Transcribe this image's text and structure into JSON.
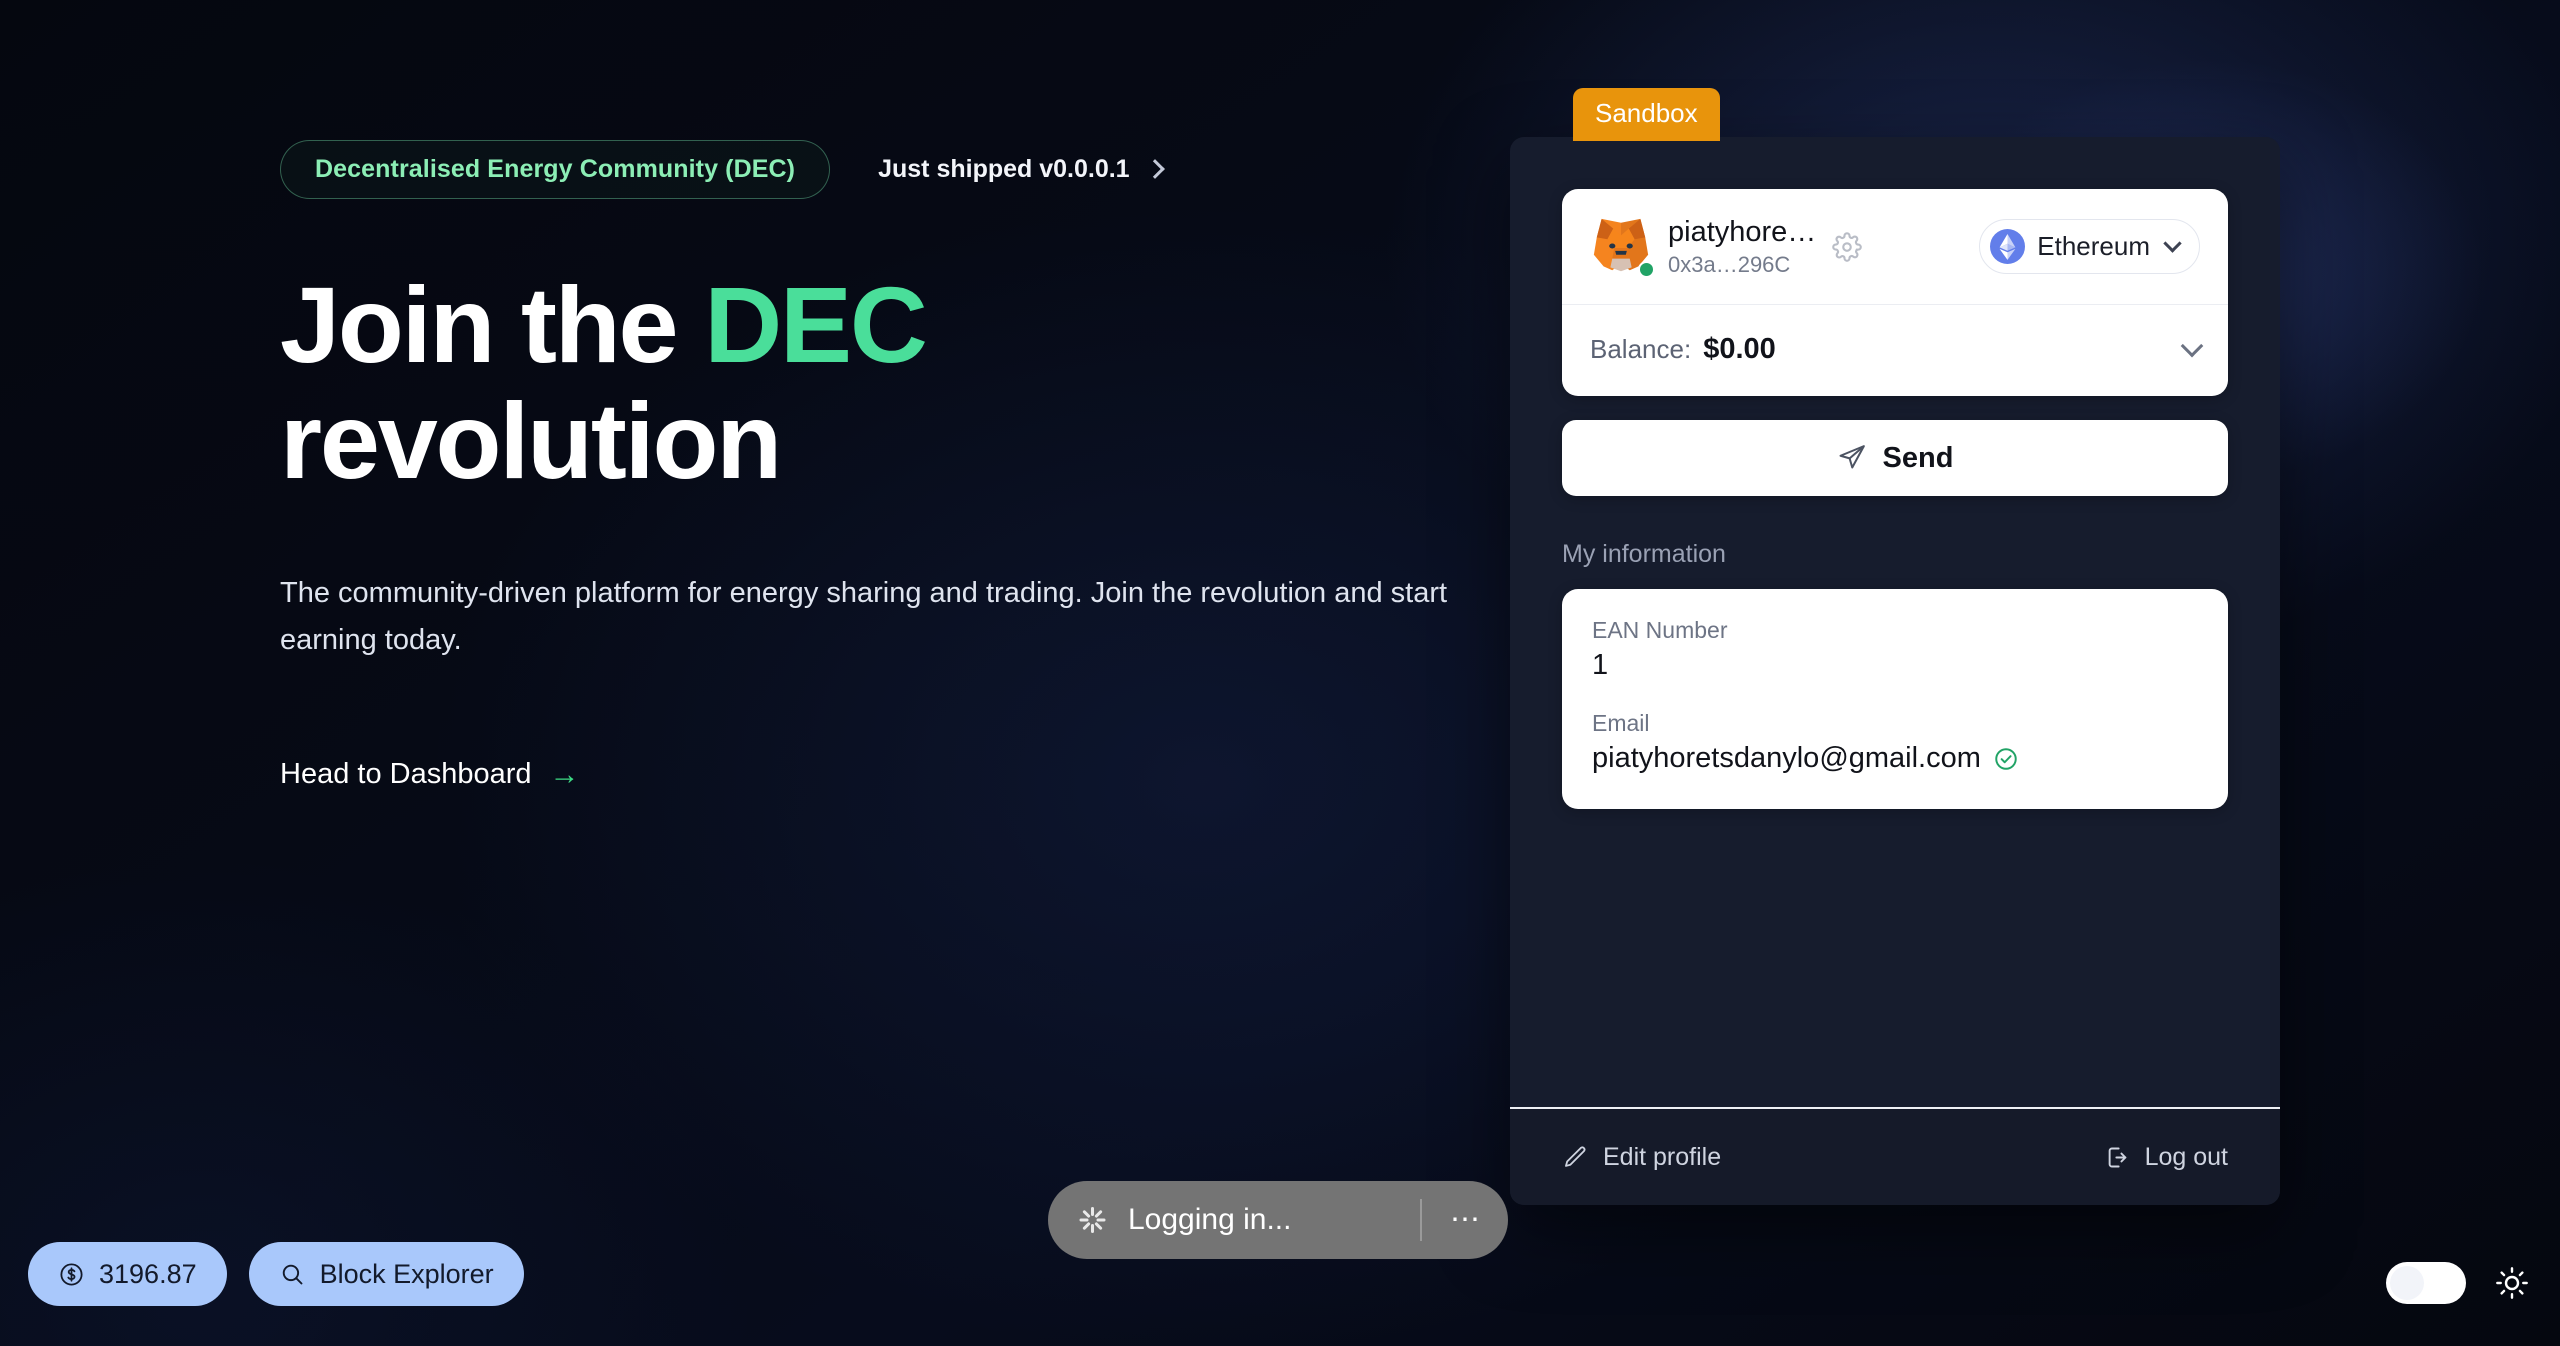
{
  "hero": {
    "badge": "Decentralised Energy Community (DEC)",
    "ship_note": "Just shipped v0.0.0.1",
    "title_line1_plain": "Join the ",
    "title_accent": "DEC",
    "title_line2": "revolution",
    "subtitle": "The community-driven platform for energy sharing and trading. Join the revolution and start earning today.",
    "cta_label": "Head to Dashboard",
    "cta_arrow": "→",
    "accent_color": "#4ade9a",
    "badge_text_color": "#8ceeb5"
  },
  "wallet": {
    "environment_badge": "Sandbox",
    "environment_badge_color": "#e8940c",
    "account": {
      "name": "piatyhore…",
      "address": "0x3a…296C",
      "avatar_icon": "metamask-fox-icon",
      "status": "connected",
      "status_color": "#21a366",
      "settings_icon": "gear-icon"
    },
    "chain": {
      "name": "Ethereum",
      "icon": "ethereum-icon",
      "icon_color": "#627eea"
    },
    "balance": {
      "label": "Balance:",
      "value": "$0.00"
    },
    "send_label": "Send",
    "send_icon": "paper-plane-icon",
    "my_information_label": "My information",
    "fields": [
      {
        "label": "EAN Number",
        "value": "1",
        "verified": false
      },
      {
        "label": "Email",
        "value": "piatyhoretsdanylo@gmail.com",
        "verified": true
      }
    ],
    "footer": {
      "edit_label": "Edit profile",
      "edit_icon": "pencil-icon",
      "logout_label": "Log out",
      "logout_icon": "logout-icon"
    }
  },
  "toast": {
    "message": "Logging in...",
    "spinner_icon": "spinner-icon",
    "more_label": "⋯",
    "background": "#747474"
  },
  "bottom_bar": {
    "balance_pill": {
      "icon": "dollar-circle-icon",
      "value": "3196.87"
    },
    "explorer_pill": {
      "icon": "search-icon",
      "label": "Block Explorer"
    },
    "pill_color": "#a9c8fb",
    "theme_toggle": {
      "state": "off",
      "icon": "sun-icon"
    }
  }
}
